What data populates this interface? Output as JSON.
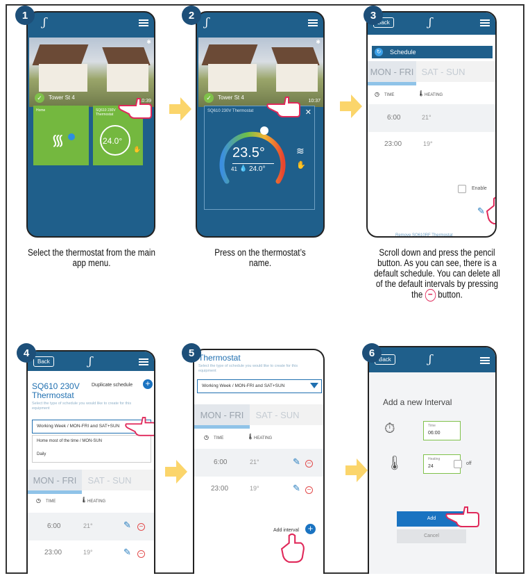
{
  "colors": {
    "accent": "#1f5f8b",
    "arrow": "#fbd56b",
    "green": "#7fc14a",
    "add_button": "#1a73c1",
    "number_badge": "#1d4f79"
  },
  "steps": [
    {
      "num": "1",
      "caption": "Select the thermostat from the main app menu.",
      "screen": {
        "location": "Tower St 4",
        "time": "10:39",
        "tile_home": "Home",
        "tile_thermostat": "SQ610 230V Thermostat",
        "temp": "24.0°"
      }
    },
    {
      "num": "2",
      "caption": "Press on the thermostat’s name.",
      "screen": {
        "location": "Tower St 4",
        "time": "10:37",
        "popup_title": "SQ610 230V Thermostat",
        "temp_main": "23.5°",
        "humidity": "41",
        "temp_set": "24.0°"
      }
    },
    {
      "num": "3",
      "caption_a": "Scroll down and press the pencil button. As you can see, there is a default schedule. You can delete all of the default intervals by pressing the",
      "caption_b": "button.",
      "screen": {
        "back": "Back",
        "section": "Schedule",
        "tab1": "MON - FRI",
        "tab2": "SAT - SUN",
        "col_time": "TIME",
        "col_heating": "HEATING",
        "rows": [
          {
            "time": "6:00",
            "temp": "21°"
          },
          {
            "time": "23:00",
            "temp": "19°"
          }
        ],
        "enable": "Enable",
        "bottom_text": "Remove SQ610RF Thermostat"
      }
    },
    {
      "num": "4",
      "screen": {
        "back": "Back",
        "title_line1": "SQ610 230V",
        "title_line2": "Thermostat",
        "duplicate": "Duplicate schedule",
        "hint": "Select the type of schedule you would like to create for this equipment",
        "selected": "Working Week / MON-FRI and SAT+SUN",
        "option1": "Home most of the time / MON-SUN",
        "option2": "Daily",
        "tab1": "MON - FRI",
        "tab2": "SAT - SUN",
        "col_time": "TIME",
        "col_heating": "HEATING",
        "rows": [
          {
            "time": "6:00",
            "temp": "21°"
          },
          {
            "time": "23:00",
            "temp": "19°"
          }
        ]
      }
    },
    {
      "num": "5",
      "screen": {
        "title": "Thermostat",
        "hint": "Select the type of schedule you would like to create for this equipment",
        "selected": "Working Week / MON-FRI and SAT+SUN",
        "tab1": "MON - FRI",
        "tab2": "SAT - SUN",
        "col_time": "TIME",
        "col_heating": "HEATING",
        "rows": [
          {
            "time": "6:00",
            "temp": "21°"
          },
          {
            "time": "23:00",
            "temp": "19°"
          }
        ],
        "add_interval": "Add interval"
      }
    },
    {
      "num": "6",
      "screen": {
        "back": "Back",
        "title": "Add a new Interval",
        "time_label": "Time",
        "time_value": "06:00",
        "heating_label": "Heating",
        "heating_value": "24",
        "off": "off",
        "add": "Add",
        "cancel": "Cancel"
      }
    }
  ]
}
